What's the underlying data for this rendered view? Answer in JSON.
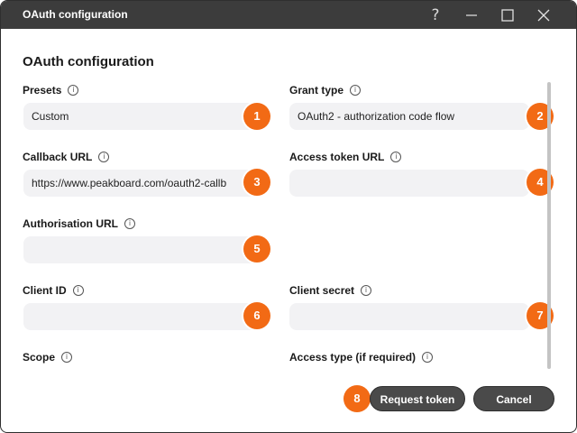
{
  "window": {
    "title": "OAuth configuration",
    "help_icon": "question-mark-icon",
    "minimize_icon": "minimize-icon",
    "maximize_icon": "maximize-icon",
    "close_icon": "close-icon"
  },
  "form": {
    "heading": "OAuth configuration",
    "info_icon": "info-icon",
    "fields": [
      {
        "label": "Presets",
        "value": "Custom",
        "badge": "1"
      },
      {
        "label": "Grant type",
        "value": "OAuth2 - authorization code flow",
        "badge": "2"
      },
      {
        "label": "Callback URL",
        "value": "https://www.peakboard.com/oauth2-callb",
        "badge": "3"
      },
      {
        "label": "Access token URL",
        "value": "",
        "badge": "4"
      },
      {
        "label": "Authorisation URL",
        "value": "",
        "badge": "5"
      },
      {
        "label": "Client ID",
        "value": "",
        "badge": "6"
      },
      {
        "label": "Client secret",
        "value": "",
        "badge": "7"
      },
      {
        "label": "Scope",
        "value": ""
      },
      {
        "label": "Access type (if required)",
        "value": ""
      }
    ]
  },
  "footer": {
    "badge": "8",
    "request_token_label": "Request token",
    "cancel_label": "Cancel"
  },
  "colors": {
    "titlebar": "#3c3c3c",
    "badge": "#f26a15",
    "button": "#4a4a4a",
    "field_bg": "#f2f2f4"
  }
}
